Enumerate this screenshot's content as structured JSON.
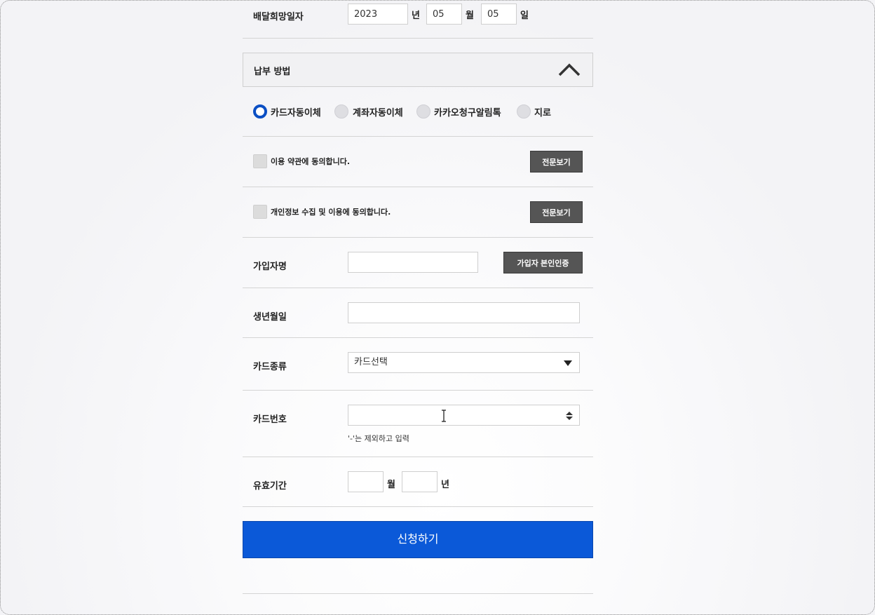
{
  "delivery_date": {
    "label": "배달희망일자",
    "year": "2023",
    "year_unit": "년",
    "month": "05",
    "month_unit": "월",
    "day": "05",
    "day_unit": "일"
  },
  "payment_section": {
    "title": "납부 방법",
    "methods": [
      {
        "label": "카드자동이체",
        "checked": true
      },
      {
        "label": "계좌자동이체",
        "checked": false
      },
      {
        "label": "카카오청구알림톡",
        "checked": false
      },
      {
        "label": "지로",
        "checked": false
      }
    ]
  },
  "agreements": {
    "terms_text": "이용 약관에 동의합니다.",
    "privacy_text": "개인정보 수집 및 이용에 동의합니다.",
    "view_full_label": "전문보기"
  },
  "subscriber": {
    "name_label": "가입자명",
    "name_value": "",
    "verify_label": "가입자 본인인증",
    "birth_label": "생년월일",
    "birth_value": ""
  },
  "card": {
    "type_label": "카드종류",
    "type_selected": "카드선택",
    "number_label": "카드번호",
    "number_value": "",
    "number_hint": "'-'는 제외하고 입력",
    "expiry_label": "유효기간",
    "expiry_month_unit": "월",
    "expiry_year_unit": "년"
  },
  "submit_label": "신청하기",
  "colors": {
    "accent": "#0b59d8",
    "radio_checked": "#0b4fc4",
    "dark_button": "#555555"
  }
}
